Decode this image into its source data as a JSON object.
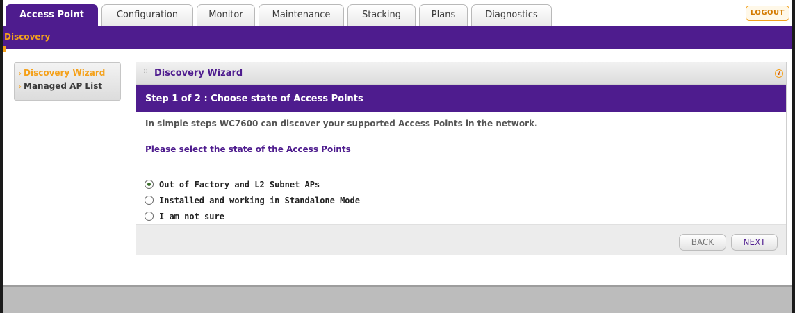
{
  "tabs": [
    {
      "label": "Access Point",
      "active": true
    },
    {
      "label": "Configuration",
      "active": false
    },
    {
      "label": "Monitor",
      "active": false
    },
    {
      "label": "Maintenance",
      "active": false
    },
    {
      "label": "Stacking",
      "active": false
    },
    {
      "label": "Plans",
      "active": false
    },
    {
      "label": "Diagnostics",
      "active": false
    }
  ],
  "logout_label": "LOGOUT",
  "subnav": {
    "active_item": "Discovery"
  },
  "sidebar": {
    "items": [
      {
        "label": "Discovery Wizard",
        "active": true
      },
      {
        "label": "Managed AP List",
        "active": false
      }
    ]
  },
  "panel": {
    "title": "Discovery Wizard",
    "help_icon": "help-icon",
    "step_title": "Step 1 of 2 : Choose state of Access Points",
    "intro": "In simple steps WC7600 can discover your supported Access Points in the network.",
    "prompt": "Please select the state of the Access Points",
    "options": [
      {
        "label": "Out of Factory and L2 Subnet APs",
        "selected": true
      },
      {
        "label": "Installed and working in Standalone Mode",
        "selected": false
      },
      {
        "label": "I am not sure",
        "selected": false
      }
    ],
    "back_label": "BACK",
    "next_label": "NEXT"
  },
  "colors": {
    "brand_purple": "#4e1c8e",
    "accent_orange": "#f4a11b"
  }
}
